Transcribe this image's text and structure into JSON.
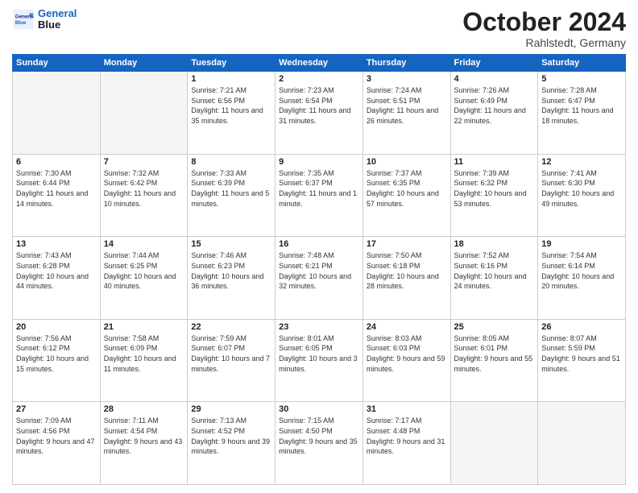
{
  "header": {
    "logo_line1": "General",
    "logo_line2": "Blue",
    "title": "October 2024",
    "subtitle": "Rahlstedt, Germany"
  },
  "weekdays": [
    "Sunday",
    "Monday",
    "Tuesday",
    "Wednesday",
    "Thursday",
    "Friday",
    "Saturday"
  ],
  "weeks": [
    [
      {
        "day": "",
        "sunrise": "",
        "sunset": "",
        "daylight": "",
        "empty": true
      },
      {
        "day": "",
        "sunrise": "",
        "sunset": "",
        "daylight": "",
        "empty": true
      },
      {
        "day": "1",
        "sunrise": "Sunrise: 7:21 AM",
        "sunset": "Sunset: 6:56 PM",
        "daylight": "Daylight: 11 hours and 35 minutes."
      },
      {
        "day": "2",
        "sunrise": "Sunrise: 7:23 AM",
        "sunset": "Sunset: 6:54 PM",
        "daylight": "Daylight: 11 hours and 31 minutes."
      },
      {
        "day": "3",
        "sunrise": "Sunrise: 7:24 AM",
        "sunset": "Sunset: 6:51 PM",
        "daylight": "Daylight: 11 hours and 26 minutes."
      },
      {
        "day": "4",
        "sunrise": "Sunrise: 7:26 AM",
        "sunset": "Sunset: 6:49 PM",
        "daylight": "Daylight: 11 hours and 22 minutes."
      },
      {
        "day": "5",
        "sunrise": "Sunrise: 7:28 AM",
        "sunset": "Sunset: 6:47 PM",
        "daylight": "Daylight: 11 hours and 18 minutes."
      }
    ],
    [
      {
        "day": "6",
        "sunrise": "Sunrise: 7:30 AM",
        "sunset": "Sunset: 6:44 PM",
        "daylight": "Daylight: 11 hours and 14 minutes."
      },
      {
        "day": "7",
        "sunrise": "Sunrise: 7:32 AM",
        "sunset": "Sunset: 6:42 PM",
        "daylight": "Daylight: 11 hours and 10 minutes."
      },
      {
        "day": "8",
        "sunrise": "Sunrise: 7:33 AM",
        "sunset": "Sunset: 6:39 PM",
        "daylight": "Daylight: 11 hours and 5 minutes."
      },
      {
        "day": "9",
        "sunrise": "Sunrise: 7:35 AM",
        "sunset": "Sunset: 6:37 PM",
        "daylight": "Daylight: 11 hours and 1 minute."
      },
      {
        "day": "10",
        "sunrise": "Sunrise: 7:37 AM",
        "sunset": "Sunset: 6:35 PM",
        "daylight": "Daylight: 10 hours and 57 minutes."
      },
      {
        "day": "11",
        "sunrise": "Sunrise: 7:39 AM",
        "sunset": "Sunset: 6:32 PM",
        "daylight": "Daylight: 10 hours and 53 minutes."
      },
      {
        "day": "12",
        "sunrise": "Sunrise: 7:41 AM",
        "sunset": "Sunset: 6:30 PM",
        "daylight": "Daylight: 10 hours and 49 minutes."
      }
    ],
    [
      {
        "day": "13",
        "sunrise": "Sunrise: 7:43 AM",
        "sunset": "Sunset: 6:28 PM",
        "daylight": "Daylight: 10 hours and 44 minutes."
      },
      {
        "day": "14",
        "sunrise": "Sunrise: 7:44 AM",
        "sunset": "Sunset: 6:25 PM",
        "daylight": "Daylight: 10 hours and 40 minutes."
      },
      {
        "day": "15",
        "sunrise": "Sunrise: 7:46 AM",
        "sunset": "Sunset: 6:23 PM",
        "daylight": "Daylight: 10 hours and 36 minutes."
      },
      {
        "day": "16",
        "sunrise": "Sunrise: 7:48 AM",
        "sunset": "Sunset: 6:21 PM",
        "daylight": "Daylight: 10 hours and 32 minutes."
      },
      {
        "day": "17",
        "sunrise": "Sunrise: 7:50 AM",
        "sunset": "Sunset: 6:18 PM",
        "daylight": "Daylight: 10 hours and 28 minutes."
      },
      {
        "day": "18",
        "sunrise": "Sunrise: 7:52 AM",
        "sunset": "Sunset: 6:16 PM",
        "daylight": "Daylight: 10 hours and 24 minutes."
      },
      {
        "day": "19",
        "sunrise": "Sunrise: 7:54 AM",
        "sunset": "Sunset: 6:14 PM",
        "daylight": "Daylight: 10 hours and 20 minutes."
      }
    ],
    [
      {
        "day": "20",
        "sunrise": "Sunrise: 7:56 AM",
        "sunset": "Sunset: 6:12 PM",
        "daylight": "Daylight: 10 hours and 15 minutes."
      },
      {
        "day": "21",
        "sunrise": "Sunrise: 7:58 AM",
        "sunset": "Sunset: 6:09 PM",
        "daylight": "Daylight: 10 hours and 11 minutes."
      },
      {
        "day": "22",
        "sunrise": "Sunrise: 7:59 AM",
        "sunset": "Sunset: 6:07 PM",
        "daylight": "Daylight: 10 hours and 7 minutes."
      },
      {
        "day": "23",
        "sunrise": "Sunrise: 8:01 AM",
        "sunset": "Sunset: 6:05 PM",
        "daylight": "Daylight: 10 hours and 3 minutes."
      },
      {
        "day": "24",
        "sunrise": "Sunrise: 8:03 AM",
        "sunset": "Sunset: 6:03 PM",
        "daylight": "Daylight: 9 hours and 59 minutes."
      },
      {
        "day": "25",
        "sunrise": "Sunrise: 8:05 AM",
        "sunset": "Sunset: 6:01 PM",
        "daylight": "Daylight: 9 hours and 55 minutes."
      },
      {
        "day": "26",
        "sunrise": "Sunrise: 8:07 AM",
        "sunset": "Sunset: 5:59 PM",
        "daylight": "Daylight: 9 hours and 51 minutes."
      }
    ],
    [
      {
        "day": "27",
        "sunrise": "Sunrise: 7:09 AM",
        "sunset": "Sunset: 4:56 PM",
        "daylight": "Daylight: 9 hours and 47 minutes."
      },
      {
        "day": "28",
        "sunrise": "Sunrise: 7:11 AM",
        "sunset": "Sunset: 4:54 PM",
        "daylight": "Daylight: 9 hours and 43 minutes."
      },
      {
        "day": "29",
        "sunrise": "Sunrise: 7:13 AM",
        "sunset": "Sunset: 4:52 PM",
        "daylight": "Daylight: 9 hours and 39 minutes."
      },
      {
        "day": "30",
        "sunrise": "Sunrise: 7:15 AM",
        "sunset": "Sunset: 4:50 PM",
        "daylight": "Daylight: 9 hours and 35 minutes."
      },
      {
        "day": "31",
        "sunrise": "Sunrise: 7:17 AM",
        "sunset": "Sunset: 4:48 PM",
        "daylight": "Daylight: 9 hours and 31 minutes."
      },
      {
        "day": "",
        "sunrise": "",
        "sunset": "",
        "daylight": "",
        "empty": true
      },
      {
        "day": "",
        "sunrise": "",
        "sunset": "",
        "daylight": "",
        "empty": true
      }
    ]
  ]
}
